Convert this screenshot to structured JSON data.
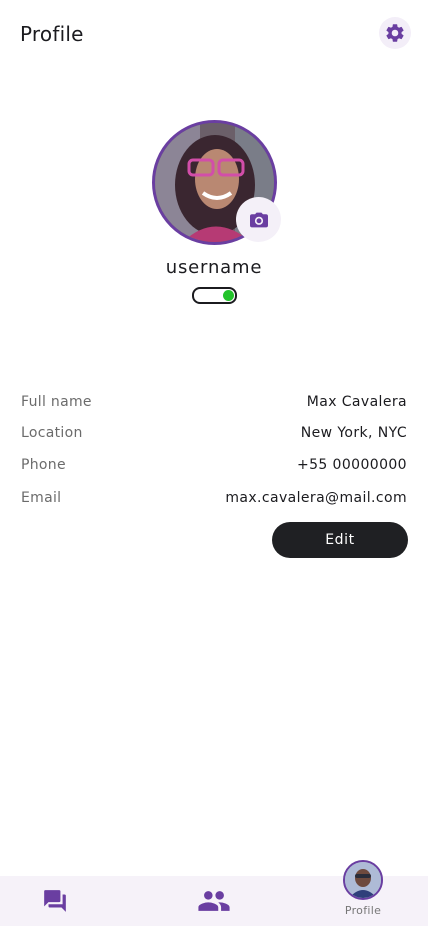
{
  "header": {
    "title": "Profile",
    "settings_icon": "gear-icon"
  },
  "profile": {
    "username": "username",
    "avatar_icon": "avatar",
    "camera_icon": "camera-icon",
    "online": true
  },
  "details": {
    "full_name_label": "Full name",
    "full_name_value": "Max Cavalera",
    "location_label": "Location",
    "location_value": "New York, NYC",
    "phone_label": "Phone",
    "phone_value": "+55 00000000",
    "email_label": "Email",
    "email_value": "max.cavalera@mail.com"
  },
  "actions": {
    "edit_label": "Edit"
  },
  "nav": {
    "chats_icon": "chat-bubbles-icon",
    "contacts_icon": "people-icon",
    "profile_label": "Profile"
  },
  "colors": {
    "accent": "#6a3ea1",
    "online": "#22c32a",
    "button_dark": "#1f2023",
    "nav_bg": "#f6f2f9"
  }
}
